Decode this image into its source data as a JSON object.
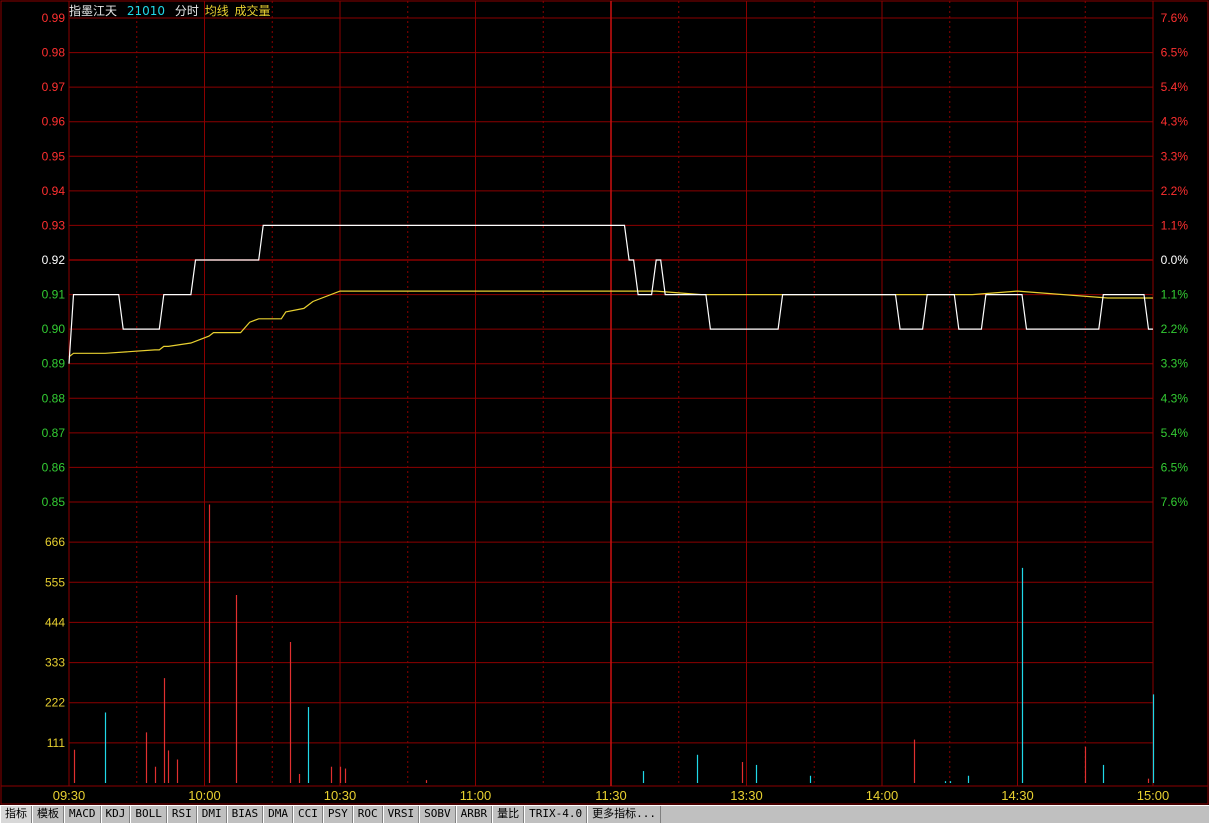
{
  "header": {
    "name": "指墨江天",
    "code": "21010",
    "mode": "分时",
    "avg_label": "均线",
    "vol_label": "成交量"
  },
  "tabs": [
    "指标",
    "模板",
    "MACD",
    "KDJ",
    "BOLL",
    "RSI",
    "DMI",
    "BIAS",
    "DMA",
    "CCI",
    "PSY",
    "ROC",
    "VRSI",
    "SOBV",
    "ARBR",
    "量比",
    "TRIX-4.0",
    "更多指标..."
  ],
  "colors": {
    "grid": "#8b0000",
    "up": "#ff3030",
    "down": "#33cc33",
    "price_line": "#ffffff",
    "avg_line": "#e8d030",
    "vol_up": "#e03030",
    "vol_down": "#20d8e8",
    "time_label": "#e8d030",
    "vol_label": "#e8d030"
  },
  "chart_data": [
    {
      "type": "line",
      "title": "",
      "prev_close": 0.92,
      "ylim": [
        0.85,
        0.99
      ],
      "y_ticks": [
        "0.99",
        "0.98",
        "0.97",
        "0.96",
        "0.95",
        "0.94",
        "0.93",
        "0.92",
        "0.91",
        "0.90",
        "0.89",
        "0.88",
        "0.87",
        "0.86",
        "0.85"
      ],
      "y_ticks_right": [
        "7.6%",
        "6.5%",
        "5.4%",
        "4.3%",
        "3.3%",
        "2.2%",
        "1.1%",
        "0.0%",
        "1.1%",
        "2.2%",
        "3.3%",
        "4.3%",
        "5.4%",
        "6.5%",
        "7.6%"
      ],
      "x_ticks": [
        "09:30",
        "10:00",
        "10:30",
        "11:00",
        "11:30",
        "13:30",
        "14:00",
        "14:30",
        "15:00"
      ],
      "series": [
        {
          "x": [
            0,
            1,
            3,
            4,
            11,
            12,
            14,
            20,
            21,
            22,
            27,
            28,
            31,
            32,
            33,
            42,
            43,
            44,
            123,
            124,
            125,
            126,
            129,
            130,
            131,
            132,
            141,
            142,
            143,
            157,
            158,
            183,
            184,
            189,
            190,
            196,
            197,
            202,
            203,
            211,
            212,
            228,
            229,
            238,
            239,
            240
          ],
          "y": [
            0.89,
            0.91,
            0.91,
            0.91,
            0.91,
            0.9,
            0.9,
            0.9,
            0.91,
            0.91,
            0.91,
            0.92,
            0.92,
            0.92,
            0.92,
            0.92,
            0.93,
            0.93,
            0.93,
            0.92,
            0.92,
            0.91,
            0.91,
            0.92,
            0.92,
            0.91,
            0.91,
            0.9,
            0.9,
            0.9,
            0.91,
            0.91,
            0.9,
            0.9,
            0.91,
            0.91,
            0.9,
            0.9,
            0.91,
            0.91,
            0.9,
            0.9,
            0.91,
            0.91,
            0.9,
            0.9
          ]
        },
        {
          "x": [
            0,
            1,
            8,
            19,
            20,
            21,
            22,
            27,
            31,
            32,
            36,
            38,
            40,
            42,
            47,
            48,
            52,
            54,
            60,
            80,
            120,
            130,
            140,
            180,
            200,
            210,
            230,
            240
          ],
          "y": [
            0.892,
            0.893,
            0.893,
            0.894,
            0.894,
            0.895,
            0.895,
            0.896,
            0.898,
            0.899,
            0.899,
            0.899,
            0.902,
            0.903,
            0.903,
            0.905,
            0.906,
            0.908,
            0.911,
            0.911,
            0.911,
            0.911,
            0.91,
            0.91,
            0.91,
            0.911,
            0.909,
            0.909
          ]
        }
      ]
    },
    {
      "type": "bar",
      "title": "",
      "ylim": [
        0,
        777
      ],
      "y_ticks": [
        "666",
        "555",
        "444",
        "333",
        "222",
        "111"
      ],
      "bars": [
        {
          "x": 1,
          "v": 92,
          "dir": "up"
        },
        {
          "x": 8,
          "v": 195,
          "dir": "down"
        },
        {
          "x": 17,
          "v": 140,
          "dir": "up"
        },
        {
          "x": 19,
          "v": 45,
          "dir": "up"
        },
        {
          "x": 21,
          "v": 290,
          "dir": "up"
        },
        {
          "x": 22,
          "v": 90,
          "dir": "up"
        },
        {
          "x": 24,
          "v": 65,
          "dir": "up"
        },
        {
          "x": 31,
          "v": 770,
          "dir": "up"
        },
        {
          "x": 37,
          "v": 520,
          "dir": "up"
        },
        {
          "x": 49,
          "v": 390,
          "dir": "up"
        },
        {
          "x": 51,
          "v": 25,
          "dir": "up"
        },
        {
          "x": 53,
          "v": 210,
          "dir": "down"
        },
        {
          "x": 58,
          "v": 45,
          "dir": "up"
        },
        {
          "x": 60,
          "v": 45,
          "dir": "up"
        },
        {
          "x": 61,
          "v": 40,
          "dir": "up"
        },
        {
          "x": 79,
          "v": 8,
          "dir": "up"
        },
        {
          "x": 127,
          "v": 33,
          "dir": "down"
        },
        {
          "x": 139,
          "v": 78,
          "dir": "down"
        },
        {
          "x": 149,
          "v": 58,
          "dir": "up"
        },
        {
          "x": 152,
          "v": 50,
          "dir": "down"
        },
        {
          "x": 164,
          "v": 20,
          "dir": "down"
        },
        {
          "x": 187,
          "v": 120,
          "dir": "up"
        },
        {
          "x": 194,
          "v": 5,
          "dir": "down"
        },
        {
          "x": 195,
          "v": 5,
          "dir": "down"
        },
        {
          "x": 199,
          "v": 20,
          "dir": "down"
        },
        {
          "x": 211,
          "v": 595,
          "dir": "down"
        },
        {
          "x": 225,
          "v": 100,
          "dir": "up"
        },
        {
          "x": 229,
          "v": 50,
          "dir": "down"
        },
        {
          "x": 239,
          "v": 12,
          "dir": "up"
        },
        {
          "x": 240,
          "v": 245,
          "dir": "down"
        }
      ]
    }
  ]
}
